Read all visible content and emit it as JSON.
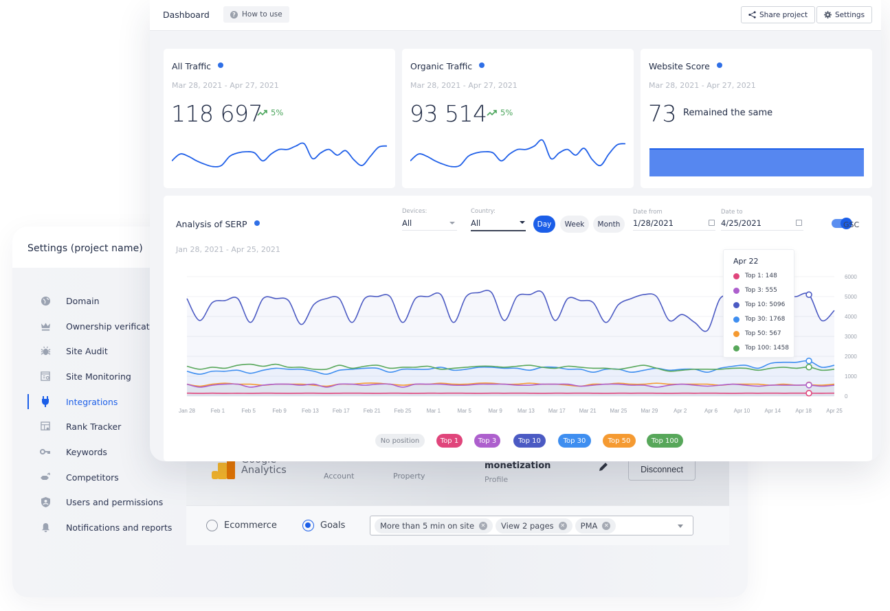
{
  "colors": {
    "accent": "#1b5ee8",
    "positive": "#4aa55b",
    "score_bar": "#5687f0",
    "top1": "#e0457b",
    "top3": "#ad5fcd",
    "top10": "#4b5ac3",
    "top30": "#3e8ef0",
    "top50": "#f59a31",
    "top100": "#57a75a",
    "no_position": "#eceef1"
  },
  "topbar": {
    "title": "Dashboard",
    "how_to_use": "How to use",
    "share_project": "Share project",
    "settings": "Settings"
  },
  "cards": [
    {
      "title": "All Traffic",
      "date_range": "Mar 28, 2021 - Apr 27, 2021",
      "value": "118 697",
      "delta": "5%",
      "trend": "up",
      "sparkline": [
        40,
        46,
        44,
        40,
        37,
        35,
        36,
        44,
        47,
        48,
        47,
        40,
        46,
        50,
        50,
        53,
        55,
        42,
        47,
        50,
        45,
        49,
        41,
        36,
        44,
        52,
        53
      ]
    },
    {
      "title": "Organic Traffic",
      "date_range": "Mar 28, 2021 - Apr 27, 2021",
      "value": "93 514",
      "delta": "5%",
      "trend": "up",
      "sparkline": [
        40,
        46,
        44,
        40,
        37,
        35,
        36,
        44,
        47,
        48,
        47,
        40,
        46,
        50,
        50,
        53,
        58,
        42,
        47,
        50,
        45,
        51,
        41,
        36,
        46,
        54,
        55
      ]
    },
    {
      "title": "Website Score",
      "date_range": "Mar 28, 2021 - Apr 27, 2021",
      "value": "73",
      "status": "Remained the same"
    }
  ],
  "serp": {
    "title": "Analysis of SERP",
    "date_range": "Jan 28, 2021 - Apr 25, 2021",
    "devices_label": "Devices:",
    "devices_value": "All",
    "country_label": "Country:",
    "country_value": "All",
    "periods": [
      "Day",
      "Week",
      "Month"
    ],
    "active_period": "Day",
    "date_from_label": "Date from",
    "date_from": "1/28/2021",
    "date_to_label": "Date to",
    "date_to": "4/25/2021",
    "gsc_label": "GSC",
    "gsc_enabled": true,
    "legend": [
      "No position",
      "Top 1",
      "Top 3",
      "Top 10",
      "Top 30",
      "Top 50",
      "Top 100"
    ],
    "tooltip": {
      "title": "Apr 22",
      "rows": [
        {
          "label": "Top 1: 148",
          "color_key": "top1"
        },
        {
          "label": "Top 3: 555",
          "color_key": "top3"
        },
        {
          "label": "Top 10: 5096",
          "color_key": "top10"
        },
        {
          "label": "Top 30: 1768",
          "color_key": "top30"
        },
        {
          "label": "Top 50: 567",
          "color_key": "top50"
        },
        {
          "label": "Top 100: 1458",
          "color_key": "top100"
        }
      ]
    }
  },
  "chart_data": {
    "type": "line",
    "title": "Analysis of SERP",
    "xlabel": "",
    "ylabel": "",
    "ylim": [
      0,
      6000
    ],
    "yticks": [
      "0",
      "1000",
      "2000",
      "3000",
      "4000",
      "5000",
      "6000"
    ],
    "xticks": [
      "Jan 28",
      "Feb 1",
      "Feb 5",
      "Feb 9",
      "Feb 13",
      "Feb 17",
      "Feb 21",
      "Feb 25",
      "Mar 1",
      "Mar 5",
      "Mar 9",
      "Mar 13",
      "Mar 17",
      "Mar 21",
      "Mar 25",
      "Mar 29",
      "Apr 2",
      "Apr 6",
      "Apr 10",
      "Apr 14",
      "Apr 18",
      "Apr 25"
    ],
    "grid": true,
    "legend_position": "bottom",
    "series": [
      {
        "name": "Top 10",
        "color_key": "top10",
        "values": [
          4900,
          3800,
          4700,
          4800,
          4900,
          3700,
          4900,
          4900,
          4800,
          3600,
          4600,
          4900,
          4900,
          3700,
          4900,
          5000,
          5000,
          3700,
          4900,
          5000,
          5100,
          3700,
          5000,
          5200,
          5200,
          3800,
          5000,
          5100,
          5200,
          3800,
          4900,
          4800,
          4700,
          3700,
          4600,
          4900,
          5100,
          5000,
          3800,
          4100,
          3700,
          3300,
          4900,
          5000,
          5100,
          4900,
          4000,
          4900,
          5000,
          5096,
          3800,
          4300
        ]
      },
      {
        "name": "Top 30",
        "color_key": "top30",
        "values": [
          1250,
          1100,
          1250,
          1250,
          1300,
          1150,
          1300,
          1400,
          1350,
          1350,
          1250,
          1100,
          1300,
          1350,
          1400,
          1400,
          1200,
          1350,
          1350,
          1350,
          1450,
          1300,
          1350,
          1450,
          1450,
          1400,
          1400,
          1300,
          1450,
          1450,
          1350,
          1350,
          1200,
          1350,
          1350,
          1200,
          1300,
          1400,
          1300,
          1350,
          1350,
          1200,
          1400,
          1500,
          1550,
          1400,
          1650,
          1700,
          1700,
          1768,
          1450,
          1550
        ]
      },
      {
        "name": "Top 100",
        "color_key": "top100",
        "values": [
          1500,
          1350,
          1450,
          1400,
          1550,
          1600,
          1500,
          1600,
          1450,
          1450,
          1350,
          1350,
          1550,
          1400,
          1500,
          1550,
          1400,
          1450,
          1450,
          1500,
          1350,
          1400,
          1450,
          1500,
          1500,
          1450,
          1500,
          1550,
          1450,
          1400,
          1500,
          1450,
          1400,
          1400,
          1350,
          1450,
          1550,
          1400,
          1250,
          1300,
          1350,
          1350,
          1350,
          1400,
          1400,
          1300,
          1400,
          1450,
          1400,
          1458,
          1300,
          1350
        ]
      },
      {
        "name": "Top 50",
        "color_key": "top50",
        "values": [
          600,
          500,
          600,
          650,
          600,
          600,
          550,
          600,
          600,
          600,
          550,
          500,
          600,
          600,
          650,
          650,
          600,
          550,
          600,
          600,
          650,
          600,
          600,
          650,
          650,
          600,
          600,
          650,
          600,
          600,
          550,
          500,
          600,
          600,
          650,
          600,
          600,
          650,
          600,
          600,
          600,
          600,
          550,
          600,
          600,
          600,
          550,
          600,
          550,
          567,
          550,
          600
        ]
      },
      {
        "name": "Top 3",
        "color_key": "top3",
        "values": [
          600,
          450,
          550,
          600,
          600,
          450,
          550,
          600,
          600,
          550,
          600,
          450,
          600,
          600,
          550,
          600,
          600,
          450,
          600,
          600,
          600,
          550,
          550,
          600,
          600,
          600,
          550,
          550,
          600,
          600,
          600,
          500,
          550,
          600,
          600,
          550,
          550,
          450,
          550,
          600,
          550,
          500,
          550,
          600,
          550,
          500,
          550,
          550,
          550,
          555,
          500,
          550
        ]
      },
      {
        "name": "Top 1",
        "color_key": "top1",
        "values": [
          150,
          140,
          150,
          140,
          145,
          140,
          150,
          145,
          140,
          145,
          150,
          140,
          145,
          150,
          145,
          140,
          150,
          145,
          140,
          150,
          145,
          150,
          145,
          140,
          150,
          145,
          150,
          145,
          140,
          150,
          145,
          150,
          145,
          140,
          150,
          145,
          150,
          145,
          140,
          150,
          145,
          150,
          145,
          140,
          150,
          145,
          150,
          145,
          150,
          148,
          145,
          150
        ]
      }
    ],
    "tooltip": {
      "x": "Apr 22",
      "values": {
        "Top 1": 148,
        "Top 3": 555,
        "Top 10": 5096,
        "Top 30": 1768,
        "Top 50": 567,
        "Top 100": 1458
      }
    }
  },
  "settings": {
    "title": "Settings (project name)",
    "nav": [
      {
        "label": "Domain",
        "icon": "globe-icon"
      },
      {
        "label": "Ownership verificatio",
        "icon": "crown-icon"
      },
      {
        "label": "Site Audit",
        "icon": "bug-icon"
      },
      {
        "label": "Site Monitoring",
        "icon": "monitor-search-icon"
      },
      {
        "label": "Integrations",
        "icon": "plug-icon",
        "active": true
      },
      {
        "label": "Rank Tracker",
        "icon": "rank-tracker-icon"
      },
      {
        "label": "Keywords",
        "icon": "key-icon"
      },
      {
        "label": "Competitors",
        "icon": "competitors-icon"
      },
      {
        "label": "Users and permissions",
        "icon": "user-shield-icon"
      },
      {
        "label": "Notifications and reports",
        "icon": "bell-icon"
      }
    ]
  },
  "integration": {
    "name_line1": "Google",
    "name_line2": "Analytics",
    "account_label": "Account",
    "property_label": "Property",
    "profile_value": "monetization",
    "profile_label": "Profile",
    "disconnect": "Disconnect",
    "tracking_options": [
      "Ecommerce",
      "Goals"
    ],
    "selected_option": "Goals",
    "goals": [
      "More than 5 min on site",
      "View 2 pages",
      "PMA"
    ]
  }
}
